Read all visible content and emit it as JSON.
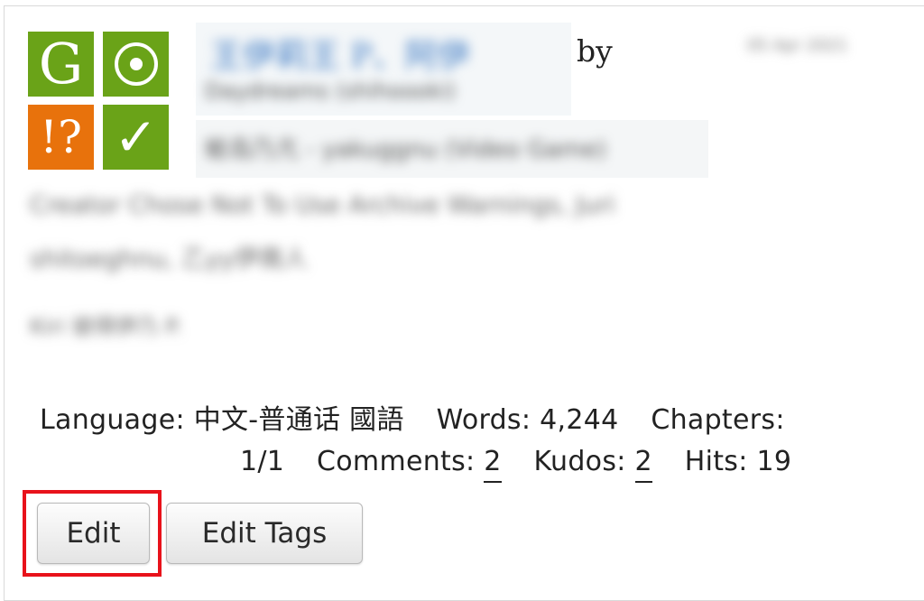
{
  "work": {
    "by_label": "by",
    "title_blurred": "王伊莉王 P、阿伊",
    "authors_blurred": "Daydreams (shihoooki)",
    "date_blurred": "05 Apr 2021",
    "fandom_blurred": "蛤岛乃亢 - yakuggnu (Video Game)",
    "warning_blurred_1": "Creator Chose Not To Use Archive Warnings, Juri",
    "warning_blurred_2": "shitoeghnu, 乙yy伊南人",
    "tag_blurred": "Kiri 彼得伊乃 P."
  },
  "icons": {
    "rating": {
      "name": "rating-general-icon",
      "symbol": "G",
      "color": "#6aa318"
    },
    "category": {
      "name": "category-icon",
      "symbol": "⊙",
      "color": "#6aa318"
    },
    "warning": {
      "name": "warning-icon",
      "symbol": "!?",
      "color": "#e8720c"
    },
    "complete": {
      "name": "complete-icon",
      "symbol": "✓",
      "color": "#6aa318"
    }
  },
  "stats": {
    "language_label": "Language:",
    "language_value": "中文-普通话 國語",
    "words_label": "Words:",
    "words_value": "4,244",
    "chapters_label": "Chapters:",
    "chapters_value": "1/1",
    "comments_label": "Comments:",
    "comments_value": "2",
    "kudos_label": "Kudos:",
    "kudos_value": "2",
    "hits_label": "Hits:",
    "hits_value": "19"
  },
  "actions": {
    "edit_label": "Edit",
    "edit_tags_label": "Edit Tags"
  },
  "colors": {
    "highlight": "#e8121b",
    "green": "#6aa318",
    "orange": "#e8720c"
  }
}
